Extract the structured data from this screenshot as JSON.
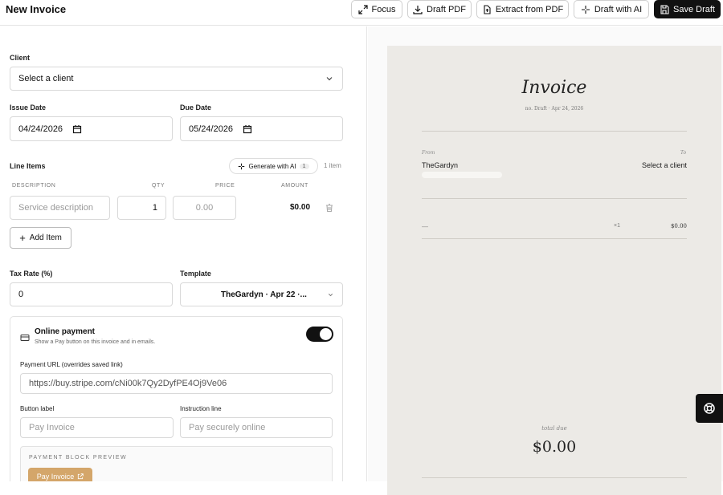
{
  "header": {
    "title": "New Invoice",
    "buttons": {
      "focus": "Focus",
      "draft_pdf": "Draft PDF",
      "extract_pdf": "Extract from PDF",
      "draft_ai": "Draft with AI",
      "save_draft": "Save Draft"
    }
  },
  "form": {
    "client": {
      "label": "Client",
      "value": "Select a client"
    },
    "issue_date": {
      "label": "Issue Date",
      "value": "04/24/2026"
    },
    "due_date": {
      "label": "Due Date",
      "value": "05/24/2026"
    },
    "line_items": {
      "label": "Line Items",
      "generate_label": "Generate with AI",
      "generate_badge": "1",
      "count": "1 item",
      "columns": {
        "description": "DESCRIPTION",
        "qty": "QTY",
        "price": "PRICE",
        "amount": "AMOUNT"
      },
      "row": {
        "description_placeholder": "Service description",
        "qty": "1",
        "price_placeholder": "0.00",
        "amount": "$0.00"
      },
      "add_label": "Add Item"
    },
    "tax_rate": {
      "label": "Tax Rate (%)",
      "value": "0"
    },
    "template": {
      "label": "Template",
      "value": "TheGardyn · Apr 22 ·..."
    },
    "online_payment": {
      "title": "Online payment",
      "subtitle": "Show a Pay button on this invoice and in emails.",
      "enabled": true,
      "url_label": "Payment URL (overrides saved link)",
      "url_value": "https://buy.stripe.com/cNi00k7Qy2DyfPE4Oj9Ve06",
      "button_label_label": "Button label",
      "button_label_placeholder": "Pay Invoice",
      "instruction_label": "Instruction line",
      "instruction_placeholder": "Pay securely online",
      "preview_label": "PAYMENT BLOCK PREVIEW",
      "preview_button": "Pay Invoice"
    }
  },
  "preview": {
    "heading": "Invoice",
    "meta": "no. Draft · Apr 24, 2026",
    "from_label": "From",
    "from_name": "TheGardyn",
    "to_label": "To",
    "to_name": "Select a client",
    "item_desc": "—",
    "item_qty": "×1",
    "item_amount": "$0.00",
    "total_label": "total due",
    "total_value": "$0.00"
  },
  "colors": {
    "accent": "#d4a66a",
    "dark": "#111111",
    "paper": "#eceae6"
  }
}
